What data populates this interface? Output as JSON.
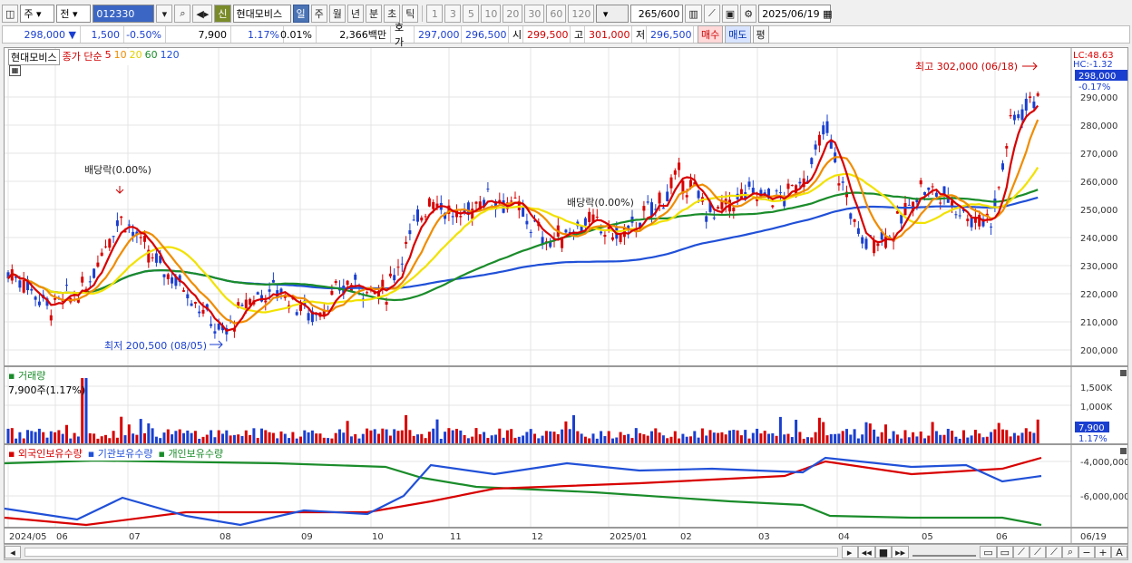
{
  "toolbar": {
    "period_type": "주",
    "prev_label": "전",
    "code": "012330",
    "new_badge": "신",
    "stock_name": "현대모비스",
    "period_tabs": [
      "일",
      "주",
      "월",
      "년",
      "분",
      "초",
      "틱"
    ],
    "active_tab": "일",
    "intervals": [
      "1",
      "3",
      "5",
      "10",
      "20",
      "30",
      "60",
      "120"
    ],
    "count": "265",
    "count_total": "/600",
    "date": "2025/06/19"
  },
  "quote": {
    "price": "298,000",
    "change": "1,500",
    "change_pct": "-0.50%",
    "volume": "7,900",
    "vol_pct": "1.17%",
    "turnover_pct": "0.01%",
    "amount": "2,366백만",
    "bid_label": "호가",
    "bid1": "297,000",
    "bid2": "296,500",
    "open_label": "시",
    "open": "299,500",
    "high_label": "고",
    "high": "301,000",
    "low_label": "저",
    "low": "296,500",
    "buy_label": "매수",
    "sell_label": "매도",
    "avg_label": "평"
  },
  "price_panel": {
    "name": "현대모비스",
    "legend_prefix": "종가 단순",
    "ma_periods": [
      "5",
      "10",
      "20",
      "60",
      "120"
    ],
    "ma_colors": [
      "#d80000",
      "#f08c00",
      "#f2e200",
      "#1a8c2a",
      "#2050d8"
    ],
    "lc_label": "LC:48.63",
    "hc_label": "HC:-1.32",
    "current_price": "298,000",
    "current_pct": "-0.17%",
    "high_annot": "최고 302,000 (06/18)",
    "low_annot": "최저 200,500 (08/05)",
    "dividend1": "배당락(0.00%)",
    "dividend2": "배당락(0.00%)",
    "y_ticks": [
      "290,000",
      "280,000",
      "270,000",
      "260,000",
      "250,000",
      "240,000",
      "230,000",
      "220,000",
      "210,000",
      "200,000"
    ]
  },
  "volume_panel": {
    "title": "거래량",
    "info": "7,900주(1.17%)",
    "y_ticks": [
      "1,500K",
      "1,000K"
    ],
    "current": "7,900",
    "current_pct": "1.17%"
  },
  "holdings_panel": {
    "series": [
      "외국인보유수량",
      "기관보유수량",
      "개인보유수량"
    ],
    "colors": [
      "#d80000",
      "#2050d8",
      "#1a8c2a"
    ],
    "y_ticks": [
      "-4,000,000",
      "-6,000,000"
    ]
  },
  "x_axis": {
    "labels": [
      "2024/05",
      "06",
      "07",
      "08",
      "09",
      "10",
      "11",
      "12",
      "2025/01",
      "02",
      "03",
      "04",
      "05",
      "06"
    ],
    "end_label": "06/19"
  }
}
